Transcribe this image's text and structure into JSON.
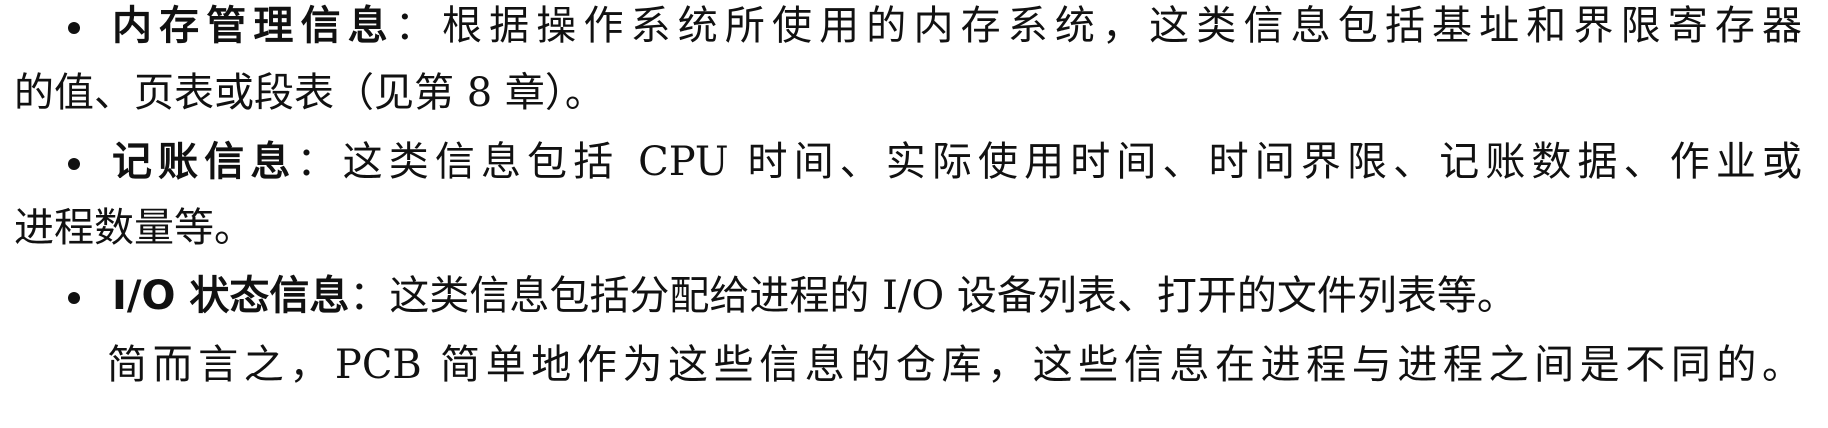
{
  "paragraphs": [
    {
      "bullet": true,
      "term": "内存管理信息",
      "colon": "：",
      "line1": "根据操作系统所使用的内存系统，这类信息包括基址和界限寄存器",
      "line2": "的值、页表或段表（见第 8 章）。"
    },
    {
      "bullet": true,
      "term": "记账信息",
      "colon": "：",
      "line1": "这类信息包括 CPU 时间、实际使用时间、时间界限、记账数据、作业或",
      "line2": "进程数量等。"
    },
    {
      "bullet": true,
      "term": "I/O 状态信息",
      "colon": "：",
      "line1": "这类信息包括分配给进程的 I/O 设备列表、打开的文件列表等。"
    },
    {
      "bullet": false,
      "text": "简而言之，PCB 简单地作为这些信息的仓库，这些信息在进程与进程之间是不同的。"
    }
  ]
}
